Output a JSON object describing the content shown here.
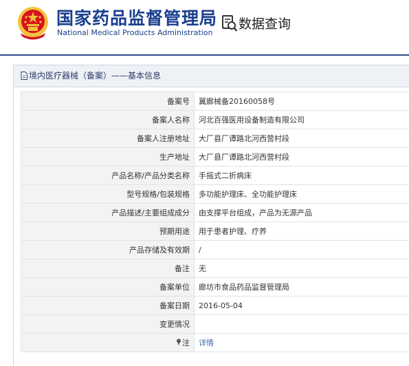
{
  "header": {
    "agency_cn": "国家药品监督管理局",
    "agency_en": "National Medical Products Administration",
    "query_label": "数据查询"
  },
  "panel": {
    "title": "境内医疗器械（备案）——基本信息"
  },
  "rows": [
    {
      "label": "备案号",
      "value": "冀廊械备20160058号"
    },
    {
      "label": "备案人名称",
      "value": "河北百强医用设备制造有限公司"
    },
    {
      "label": "备案人注册地址",
      "value": "大厂县厂谭路北河西营村段"
    },
    {
      "label": "生产地址",
      "value": "大厂县厂谭路北河西营村段"
    },
    {
      "label": "产品名称/产品分类名称",
      "value": "手摇式二折病床"
    },
    {
      "label": "型号规格/包装规格",
      "value": "多功能护理床、全功能护理床"
    },
    {
      "label": "产品描述/主要组成成分",
      "value": "由支撑平台组成，产品为无源产品"
    },
    {
      "label": "预期用途",
      "value": "用于患者护理、疗养"
    },
    {
      "label": "产品存储及有效期",
      "value": "/"
    },
    {
      "label": "备注",
      "value": "无"
    },
    {
      "label": "备案单位",
      "value": "廊坊市食品药品监督管理局"
    },
    {
      "label": "备案日期",
      "value": "2016-05-04"
    },
    {
      "label": "变更情况",
      "value": ""
    },
    {
      "label": "注",
      "value": "详情"
    }
  ],
  "icons": {
    "emblem": "national-emblem-icon",
    "query": "data-query-icon",
    "doc": "document-icon",
    "pin": "pin-icon"
  },
  "colors": {
    "brand_blue": "#1b3f8f",
    "link_blue": "#3d6bb3",
    "emblem_red": "#d9121f",
    "emblem_gold": "#f3c23c"
  }
}
